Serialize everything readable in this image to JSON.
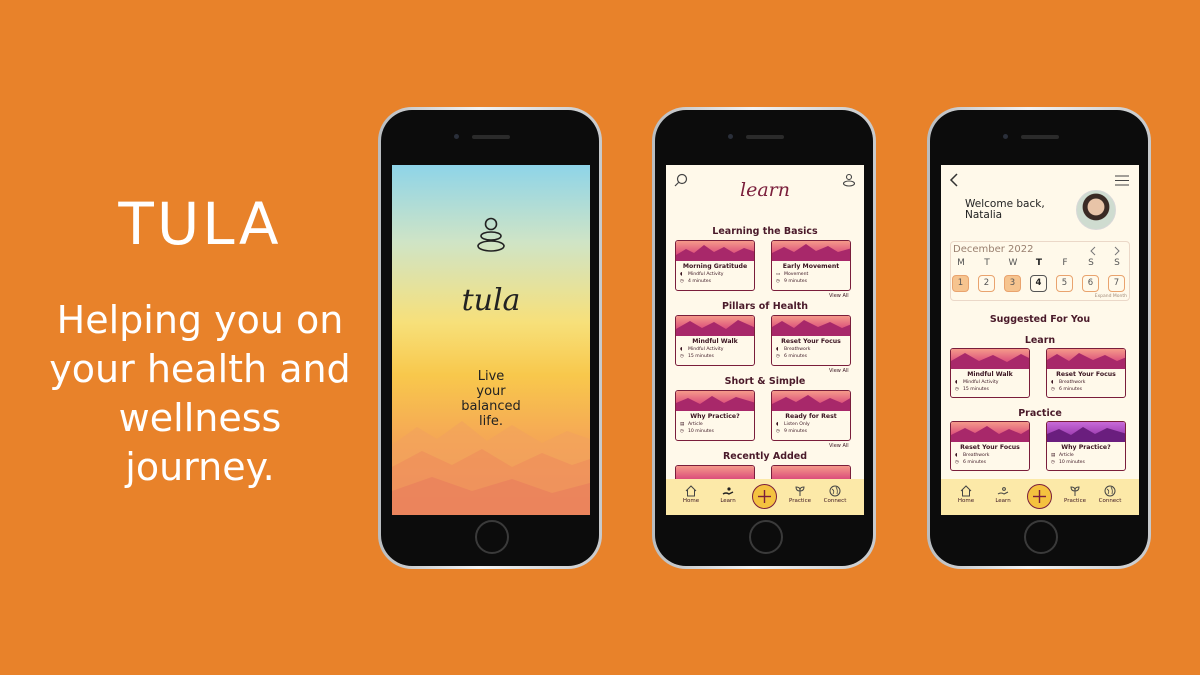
{
  "hero": {
    "brand": "TULA",
    "tagline": "Helping you on your health and wellness journey."
  },
  "splash": {
    "logo_text": "tula",
    "motto": "Live\nyour\nbalanced\nlife."
  },
  "learn": {
    "title": "learn",
    "sections": [
      {
        "heading": "Learning the Basics",
        "cards": [
          {
            "title": "Morning Gratitude",
            "type": "Mindful Activity",
            "duration": "4 minutes"
          },
          {
            "title": "Early Movement",
            "type": "Movement",
            "duration": "9 minutes"
          }
        ],
        "view_all": "View All"
      },
      {
        "heading": "Pillars of Health",
        "cards": [
          {
            "title": "Mindful Walk",
            "type": "Mindful Activity",
            "duration": "15 minutes"
          },
          {
            "title": "Reset Your Focus",
            "type": "Breathwork",
            "duration": "6 minutes"
          }
        ],
        "view_all": "View All"
      },
      {
        "heading": "Short & Simple",
        "cards": [
          {
            "title": "Why Practice?",
            "type": "Article",
            "duration": "10 minutes"
          },
          {
            "title": "Ready for Rest",
            "type": "Listen Only",
            "duration": "9 minutes"
          }
        ],
        "view_all": "View All"
      },
      {
        "heading": "Recently Added",
        "cards": []
      }
    ]
  },
  "tabbar": {
    "home": "Home",
    "learn": "Learn",
    "practice": "Practice",
    "connect": "Connect"
  },
  "home": {
    "welcome": "Welcome back,\nNatalia",
    "calendar": {
      "month": "December 2022",
      "dow": [
        "M",
        "T",
        "W",
        "T",
        "F",
        "S",
        "S"
      ],
      "days": [
        "1",
        "2",
        "3",
        "4",
        "5",
        "6",
        "7"
      ],
      "expand": "Expand Month"
    },
    "suggested": "Suggested For You",
    "learn_h": "Learn",
    "practice_h": "Practice",
    "learn_cards": [
      {
        "title": "Mindful Walk",
        "type": "Mindful Activity",
        "duration": "15 minutes"
      },
      {
        "title": "Reset Your Focus",
        "type": "Breathwork",
        "duration": "6 minutes"
      }
    ],
    "practice_cards": [
      {
        "title": "Reset Your Focus",
        "type": "Breathwork",
        "duration": "6 minutes"
      },
      {
        "title": "Why Practice?",
        "type": "Article",
        "duration": "10 minutes"
      }
    ]
  },
  "colors": {
    "background": "#E8822A",
    "accent": "#7A1E3B",
    "cream": "#FFF9EA",
    "tabbar": "#FCE9A8"
  }
}
